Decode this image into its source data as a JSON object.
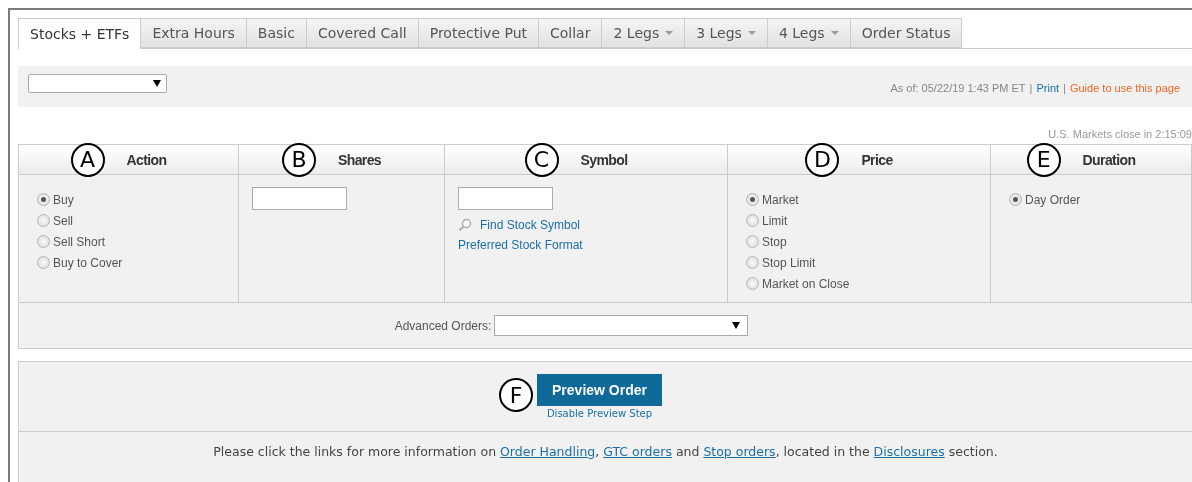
{
  "tabs": [
    {
      "label": "Stocks + ETFs",
      "selected": true,
      "dropdown": false
    },
    {
      "label": "Extra Hours",
      "selected": false,
      "dropdown": false
    },
    {
      "label": "Basic",
      "selected": false,
      "dropdown": false
    },
    {
      "label": "Covered Call",
      "selected": false,
      "dropdown": false
    },
    {
      "label": "Protective Put",
      "selected": false,
      "dropdown": false
    },
    {
      "label": "Collar",
      "selected": false,
      "dropdown": false
    },
    {
      "label": "2 Legs",
      "selected": false,
      "dropdown": true
    },
    {
      "label": "3 Legs",
      "selected": false,
      "dropdown": true
    },
    {
      "label": "4 Legs",
      "selected": false,
      "dropdown": true
    },
    {
      "label": "Order Status",
      "selected": false,
      "dropdown": false
    }
  ],
  "toolbar": {
    "info": [
      {
        "kind": "text",
        "text": "As of: 05/22/19 1:43 PM ET"
      },
      {
        "kind": "separator",
        "text": "|"
      },
      {
        "kind": "link",
        "text": "Print"
      },
      {
        "kind": "separator",
        "text": "|"
      },
      {
        "kind": "guide",
        "text": "Guide to use this page"
      }
    ]
  },
  "market_close": "U.S. Markets close in 2:15:09",
  "order_form": {
    "columns": [
      {
        "marker": "A",
        "title": "Action",
        "kind": "radios",
        "options": [
          {
            "label": "Buy",
            "selected": true
          },
          {
            "label": "Sell",
            "selected": false
          },
          {
            "label": "Sell Short",
            "selected": false
          },
          {
            "label": "Buy to Cover",
            "selected": false
          }
        ]
      },
      {
        "marker": "B",
        "title": "Shares",
        "kind": "input"
      },
      {
        "marker": "C",
        "title": "Symbol",
        "kind": "input",
        "links": [
          {
            "kind": "search",
            "label": "Find Stock Symbol"
          },
          {
            "kind": "plain",
            "label": "Preferred Stock Format"
          }
        ]
      },
      {
        "marker": "D",
        "title": "Price",
        "kind": "radios",
        "options": [
          {
            "label": "Market",
            "selected": true
          },
          {
            "label": "Limit",
            "selected": false
          },
          {
            "label": "Stop",
            "selected": false
          },
          {
            "label": "Stop Limit",
            "selected": false
          },
          {
            "label": "Market on Close",
            "selected": false
          }
        ]
      },
      {
        "marker": "E",
        "title": "Duration",
        "kind": "radios",
        "options": [
          {
            "label": "Day Order",
            "selected": true
          }
        ]
      }
    ],
    "advanced_orders": {
      "label": "Advanced Orders:"
    }
  },
  "preview": {
    "marker": "F",
    "button": "Preview Order",
    "link": "Disable Preview Step"
  },
  "footnote": [
    {
      "kind": "text",
      "text": "Please click the links for more information on "
    },
    {
      "kind": "link",
      "text": "Order Handling"
    },
    {
      "kind": "text",
      "text": ", "
    },
    {
      "kind": "link",
      "text": "GTC orders"
    },
    {
      "kind": "text",
      "text": " and "
    },
    {
      "kind": "link",
      "text": "Stop orders"
    },
    {
      "kind": "text",
      "text": ", located in the "
    },
    {
      "kind": "link",
      "text": "Disclosures"
    },
    {
      "kind": "text",
      "text": " section."
    }
  ]
}
